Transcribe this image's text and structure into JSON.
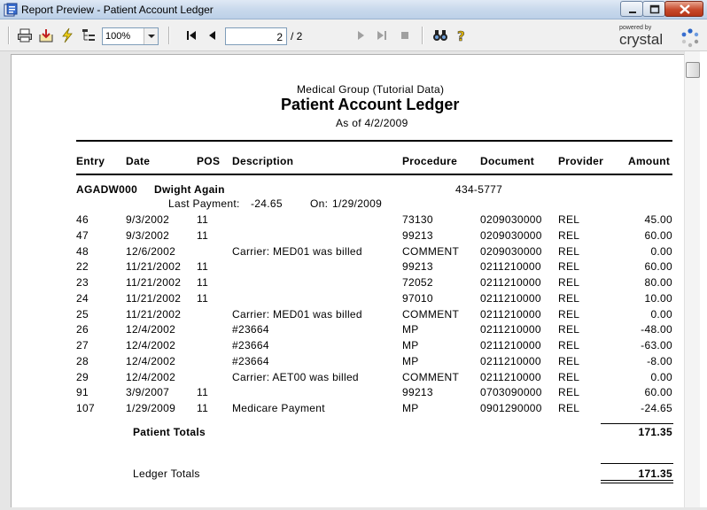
{
  "window": {
    "title": "Report Preview - Patient Account Ledger"
  },
  "toolbar": {
    "icons": [
      "printer-icon",
      "export-icon",
      "refresh-icon",
      "group-tree-icon",
      "first-page-icon",
      "prev-page-icon",
      "next-page-icon",
      "last-page-icon",
      "stop-icon",
      "search-icon",
      "help-icon"
    ],
    "zoom": "100%",
    "current_page": "2",
    "page_total": "/ 2",
    "logo_powered": "powered by",
    "logo_word": "crystal"
  },
  "report": {
    "company": "Medical Group (Tutorial Data)",
    "title": "Patient Account Ledger",
    "as_of": "As of 4/2/2009",
    "columns": [
      "Entry",
      "Date",
      "POS",
      "Description",
      "Procedure",
      "Document",
      "Provider",
      "Amount"
    ],
    "patient": {
      "account": "AGADW000",
      "name": "Dwight  Again",
      "phone": "434-5777",
      "last_payment_label": "Last Payment:",
      "last_payment_amount": "-24.65",
      "last_payment_on_label": "On:",
      "last_payment_date": "1/29/2009"
    },
    "rows": [
      {
        "entry": "46",
        "date": "9/3/2002",
        "pos": "11",
        "description": "",
        "procedure": "73130",
        "document": "0209030000",
        "provider": "REL",
        "amount": "45.00"
      },
      {
        "entry": "47",
        "date": "9/3/2002",
        "pos": "11",
        "description": "",
        "procedure": "99213",
        "document": "0209030000",
        "provider": "REL",
        "amount": "60.00"
      },
      {
        "entry": "48",
        "date": "12/6/2002",
        "pos": "",
        "description": "Carrier: MED01 was billed",
        "procedure": "COMMENT",
        "document": "0209030000",
        "provider": "REL",
        "amount": "0.00"
      },
      {
        "entry": "22",
        "date": "11/21/2002",
        "pos": "11",
        "description": "",
        "procedure": "99213",
        "document": "0211210000",
        "provider": "REL",
        "amount": "60.00"
      },
      {
        "entry": "23",
        "date": "11/21/2002",
        "pos": "11",
        "description": "",
        "procedure": "72052",
        "document": "0211210000",
        "provider": "REL",
        "amount": "80.00"
      },
      {
        "entry": "24",
        "date": "11/21/2002",
        "pos": "11",
        "description": "",
        "procedure": "97010",
        "document": "0211210000",
        "provider": "REL",
        "amount": "10.00"
      },
      {
        "entry": "25",
        "date": "11/21/2002",
        "pos": "",
        "description": "Carrier: MED01 was billed",
        "procedure": "COMMENT",
        "document": "0211210000",
        "provider": "REL",
        "amount": "0.00"
      },
      {
        "entry": "26",
        "date": "12/4/2002",
        "pos": "",
        "description": "#23664",
        "procedure": "MP",
        "document": "0211210000",
        "provider": "REL",
        "amount": "-48.00"
      },
      {
        "entry": "27",
        "date": "12/4/2002",
        "pos": "",
        "description": "#23664",
        "procedure": "MP",
        "document": "0211210000",
        "provider": "REL",
        "amount": "-63.00"
      },
      {
        "entry": "28",
        "date": "12/4/2002",
        "pos": "",
        "description": "#23664",
        "procedure": "MP",
        "document": "0211210000",
        "provider": "REL",
        "amount": "-8.00"
      },
      {
        "entry": "29",
        "date": "12/4/2002",
        "pos": "",
        "description": "Carrier: AET00 was billed",
        "procedure": "COMMENT",
        "document": "0211210000",
        "provider": "REL",
        "amount": "0.00"
      },
      {
        "entry": "91",
        "date": "3/9/2007",
        "pos": "11",
        "description": "",
        "procedure": "99213",
        "document": "0703090000",
        "provider": "REL",
        "amount": "60.00"
      },
      {
        "entry": "107",
        "date": "1/29/2009",
        "pos": "11",
        "description": "Medicare Payment",
        "procedure": "MP",
        "document": "0901290000",
        "provider": "REL",
        "amount": "-24.65"
      }
    ],
    "patient_totals_label": "Patient Totals",
    "patient_totals_value": "171.35",
    "ledger_totals_label": "Ledger Totals",
    "ledger_totals_value": "171.35"
  }
}
